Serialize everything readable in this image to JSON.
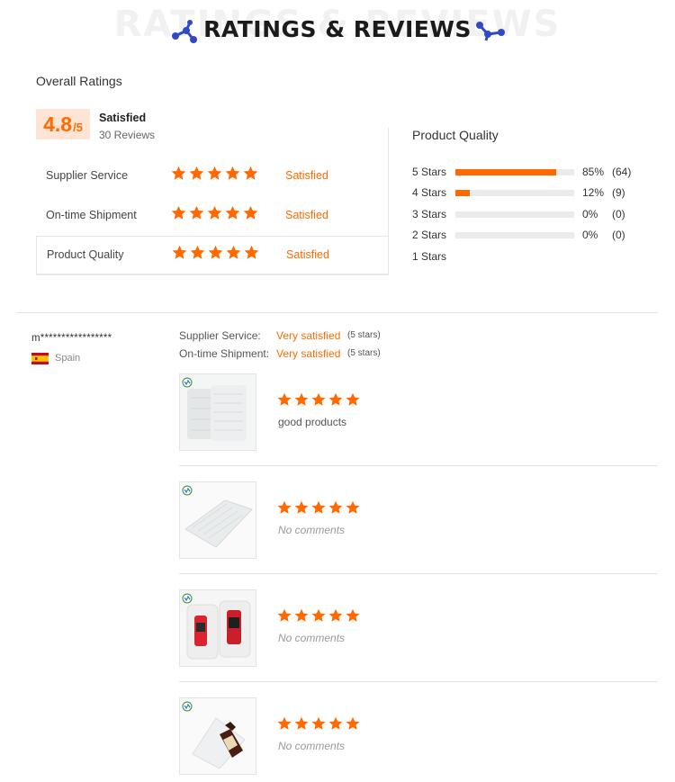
{
  "header": {
    "title": "RATINGS & REVIEWS",
    "watermark": "RATINGS & REVIEWS"
  },
  "overall": {
    "heading": "Overall Ratings",
    "score": "4.8",
    "score_suffix": "/5",
    "status": "Satisfied",
    "reviews_count": "30 Reviews",
    "accent_color": "#ff6a00",
    "categories": [
      {
        "label": "Supplier Service",
        "stars": 5,
        "status": "Satisfied"
      },
      {
        "label": "On-time Shipment",
        "stars": 5,
        "status": "Satisfied"
      },
      {
        "label": "Product Quality",
        "stars": 5,
        "status": "Satisfied"
      }
    ]
  },
  "product_quality": {
    "title": "Product Quality",
    "distribution": [
      {
        "label": "5  Stars",
        "fraction": 0.85,
        "percent": "85%",
        "count": "(64)"
      },
      {
        "label": "4  Stars",
        "fraction": 0.12,
        "percent": "12%",
        "count": "(9)"
      },
      {
        "label": "3  Stars",
        "fraction": 0,
        "percent": "0%",
        "count": "(0)"
      },
      {
        "label": "2  Stars",
        "fraction": 0,
        "percent": "0%",
        "count": "(0)"
      },
      {
        "label": "1  Stars",
        "fraction": 0,
        "percent": "",
        "count": ""
      }
    ]
  },
  "review": {
    "reviewer": "m*****************",
    "country": "Spain",
    "flag_icon": "spain-flag-icon",
    "supplier_service_label": "Supplier Service:",
    "supplier_service_value": "Very satisfied",
    "supplier_service_stars": "(5 stars)",
    "shipment_label": "On-time Shipment:",
    "shipment_value": "Very satisfied",
    "shipment_stars": "(5 stars)",
    "items": [
      {
        "image": "air-column-roll-image",
        "stars": 5,
        "comment": "good products",
        "empty": false
      },
      {
        "image": "air-column-bag-image",
        "stars": 5,
        "comment": "No comments",
        "empty": true
      },
      {
        "image": "air-column-cans-image",
        "stars": 5,
        "comment": "No comments",
        "empty": true
      },
      {
        "image": "air-column-wine-bottle-image",
        "stars": 5,
        "comment": "No comments",
        "empty": true
      }
    ]
  }
}
